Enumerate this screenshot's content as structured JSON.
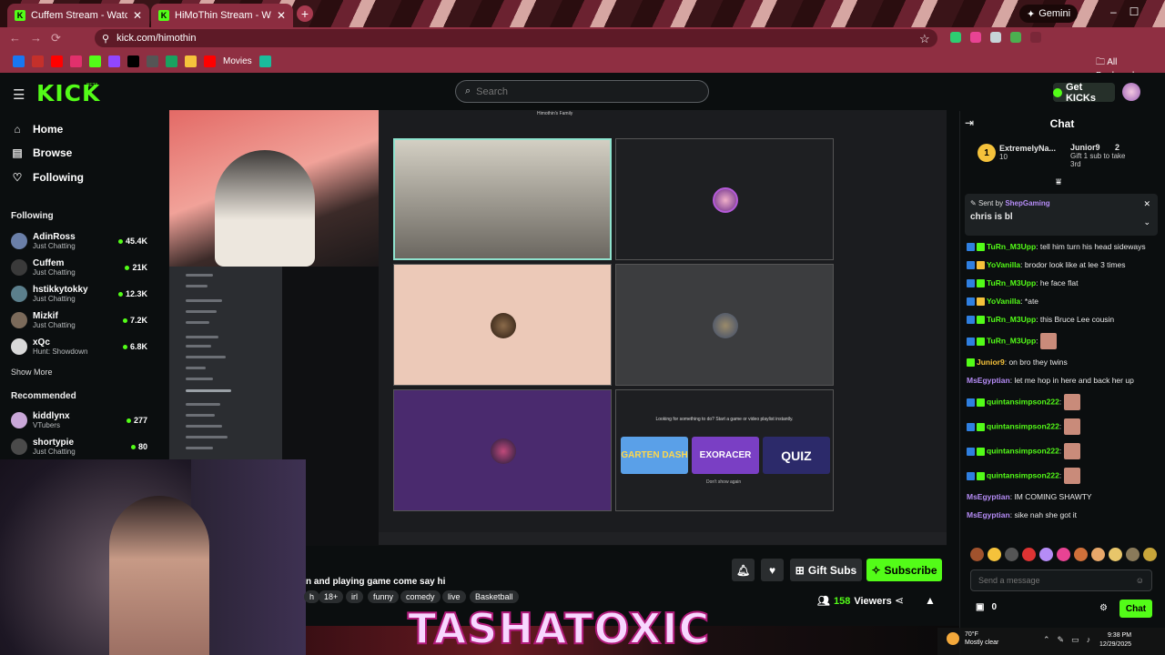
{
  "browser": {
    "tabs": [
      {
        "title": "Cuffem Stream - Watch Live on Kick",
        "active": false
      },
      {
        "title": "HiMoThin Stream - Watch Live on Kick",
        "active": true
      }
    ],
    "gemini_label": "Gemini",
    "url": "kick.com/himothin",
    "bookmarks": {
      "movies": "Movies",
      "all": "All Bookmarks"
    }
  },
  "header": {
    "logo": "KICK",
    "beta": "BETA",
    "search_placeholder": "Search",
    "get_kicks": "Get KICKs"
  },
  "sidebar": {
    "nav": [
      {
        "label": "Home",
        "icon": "home-icon"
      },
      {
        "label": "Browse",
        "icon": "browse-icon"
      },
      {
        "label": "Following",
        "icon": "heart-icon"
      }
    ],
    "following_title": "Following",
    "following": [
      {
        "name": "AdinRoss",
        "category": "Just Chatting",
        "viewers": "45.4K",
        "color": "#6a7fa8"
      },
      {
        "name": "Cuffem",
        "category": "Just Chatting",
        "viewers": "21K",
        "color": "#3a3a3a"
      },
      {
        "name": "hstikkytokky",
        "category": "Just Chatting",
        "viewers": "12.3K",
        "color": "#5b7f8c"
      },
      {
        "name": "Mizkif",
        "category": "Just Chatting",
        "viewers": "7.2K",
        "color": "#7b6a5a"
      },
      {
        "name": "xQc",
        "category": "Hunt: Showdown",
        "viewers": "6.8K",
        "color": "#d9d9d9"
      }
    ],
    "show_more": "Show More",
    "recommended_title": "Recommended",
    "recommended": [
      {
        "name": "kiddlynx",
        "category": "VTubers",
        "viewers": "277",
        "color": "#c9a7d8"
      },
      {
        "name": "shortypie",
        "category": "Just Chatting",
        "viewers": "80",
        "color": "#4a4a4a"
      }
    ]
  },
  "video": {
    "call_title": "Himothin's Family",
    "promo_text": "Looking for something to do? Start a game or video playlist instantly.",
    "promo_dont_show": "Don't show again",
    "games": [
      {
        "label": "GARTEN DASH",
        "color": "#5aa0e8"
      },
      {
        "label": "EXORACER",
        "color": "#7a3fc4"
      },
      {
        "label": "QUIZ",
        "color": "#2c2a6a"
      }
    ]
  },
  "stream": {
    "title_fragment": "n and playing game come say hi",
    "tags": [
      "h",
      "18+",
      "irl",
      "funny",
      "comedy",
      "live",
      "Basketball"
    ],
    "gift_subs": "Gift Subs",
    "subscribe": "Subscribe",
    "viewers_count": "158",
    "viewers_label": "Viewers",
    "overlay_title": "TASHATOXIC"
  },
  "chat": {
    "title": "Chat",
    "gifter_top": {
      "rank": "1",
      "name": "ExtremelyNa...",
      "count": "10"
    },
    "gifter_second": {
      "name": "Junior9",
      "count": "2",
      "note": "Gift 1 sub to take 3rd"
    },
    "pinned": {
      "sent_by": "Sent by",
      "sender": "ShepGaming",
      "message": "chris is bl"
    },
    "messages": [
      {
        "user": "TuRn_M3Upp",
        "color": "#53fc18",
        "text": "tell him turn his head sideways"
      },
      {
        "user": "YoVanilla",
        "color": "#53fc18",
        "text": "brodor look like at lee 3 times"
      },
      {
        "user": "TuRn_M3Upp",
        "color": "#53fc18",
        "text": "he face flat"
      },
      {
        "user": "YoVanilla",
        "color": "#53fc18",
        "text": "*ate"
      },
      {
        "user": "TuRn_M3Upp",
        "color": "#53fc18",
        "text": "this Bruce Lee cousin"
      },
      {
        "user": "TuRn_M3Upp",
        "color": "#53fc18",
        "text": ""
      },
      {
        "user": "Junior9",
        "color": "#f5c23b",
        "text": "on bro they twins"
      },
      {
        "user": "MsEgyptian",
        "color": "#b58cf6",
        "text": "let me hop in here and back her up"
      },
      {
        "user": "quintansimpson222",
        "color": "#53fc18",
        "text": ""
      },
      {
        "user": "quintansimpson222",
        "color": "#53fc18",
        "text": ""
      },
      {
        "user": "quintansimpson222",
        "color": "#53fc18",
        "text": ""
      },
      {
        "user": "quintansimpson222",
        "color": "#53fc18",
        "text": ""
      },
      {
        "user": "MsEgyptian",
        "color": "#b58cf6",
        "text": "IM COMING SHAWTY"
      },
      {
        "user": "MsEgyptian",
        "color": "#b58cf6",
        "text": "sike nah she got it"
      }
    ],
    "input_placeholder": "Send a message",
    "kicks_count": "0",
    "chat_button": "Chat"
  },
  "taskbar": {
    "temp": "70°F",
    "weather": "Mostly clear",
    "time": "9:38 PM",
    "date": "12/29/2025"
  }
}
